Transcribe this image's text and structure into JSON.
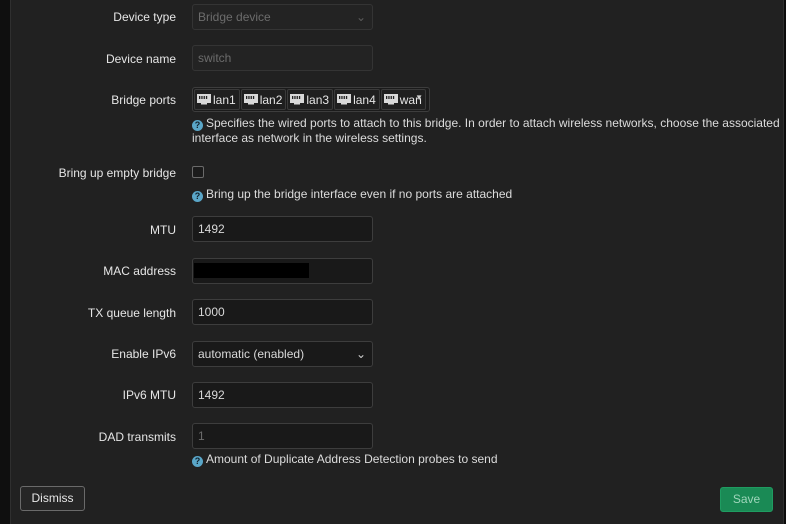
{
  "form": {
    "device_type": {
      "label": "Device type",
      "value": "Bridge device"
    },
    "device_name": {
      "label": "Device name",
      "placeholder": "switch"
    },
    "bridge_ports": {
      "label": "Bridge ports",
      "ports": [
        "lan1",
        "lan2",
        "lan3",
        "lan4",
        "wan"
      ],
      "help": "Specifies the wired ports to attach to this bridge. In order to attach wireless networks, choose the associated",
      "help2": "interface as network in the wireless settings."
    },
    "empty_bridge": {
      "label": "Bring up empty bridge",
      "checked": false,
      "help": "Bring up the bridge interface even if no ports are attached"
    },
    "mtu": {
      "label": "MTU",
      "value": "1492"
    },
    "mac": {
      "label": "MAC address",
      "value": ""
    },
    "txqueuelen": {
      "label": "TX queue length",
      "value": "1000"
    },
    "ipv6": {
      "label": "Enable IPv6",
      "value": "automatic (enabled)"
    },
    "ipv6_mtu": {
      "label": "IPv6 MTU",
      "value": "1492"
    },
    "dad": {
      "label": "DAD transmits",
      "placeholder": "1",
      "help": "Amount of Duplicate Address Detection probes to send"
    }
  },
  "icons": {
    "help": "help-circle-icon",
    "port": "ethernet-port-icon",
    "dropdown": "chevron-down-icon"
  },
  "buttons": {
    "dismiss": "Dismiss",
    "save": "Save"
  },
  "colors": {
    "save_bg": "#1a8a55",
    "help_icon": "#5aa6c8",
    "modal_bg": "#212121"
  }
}
